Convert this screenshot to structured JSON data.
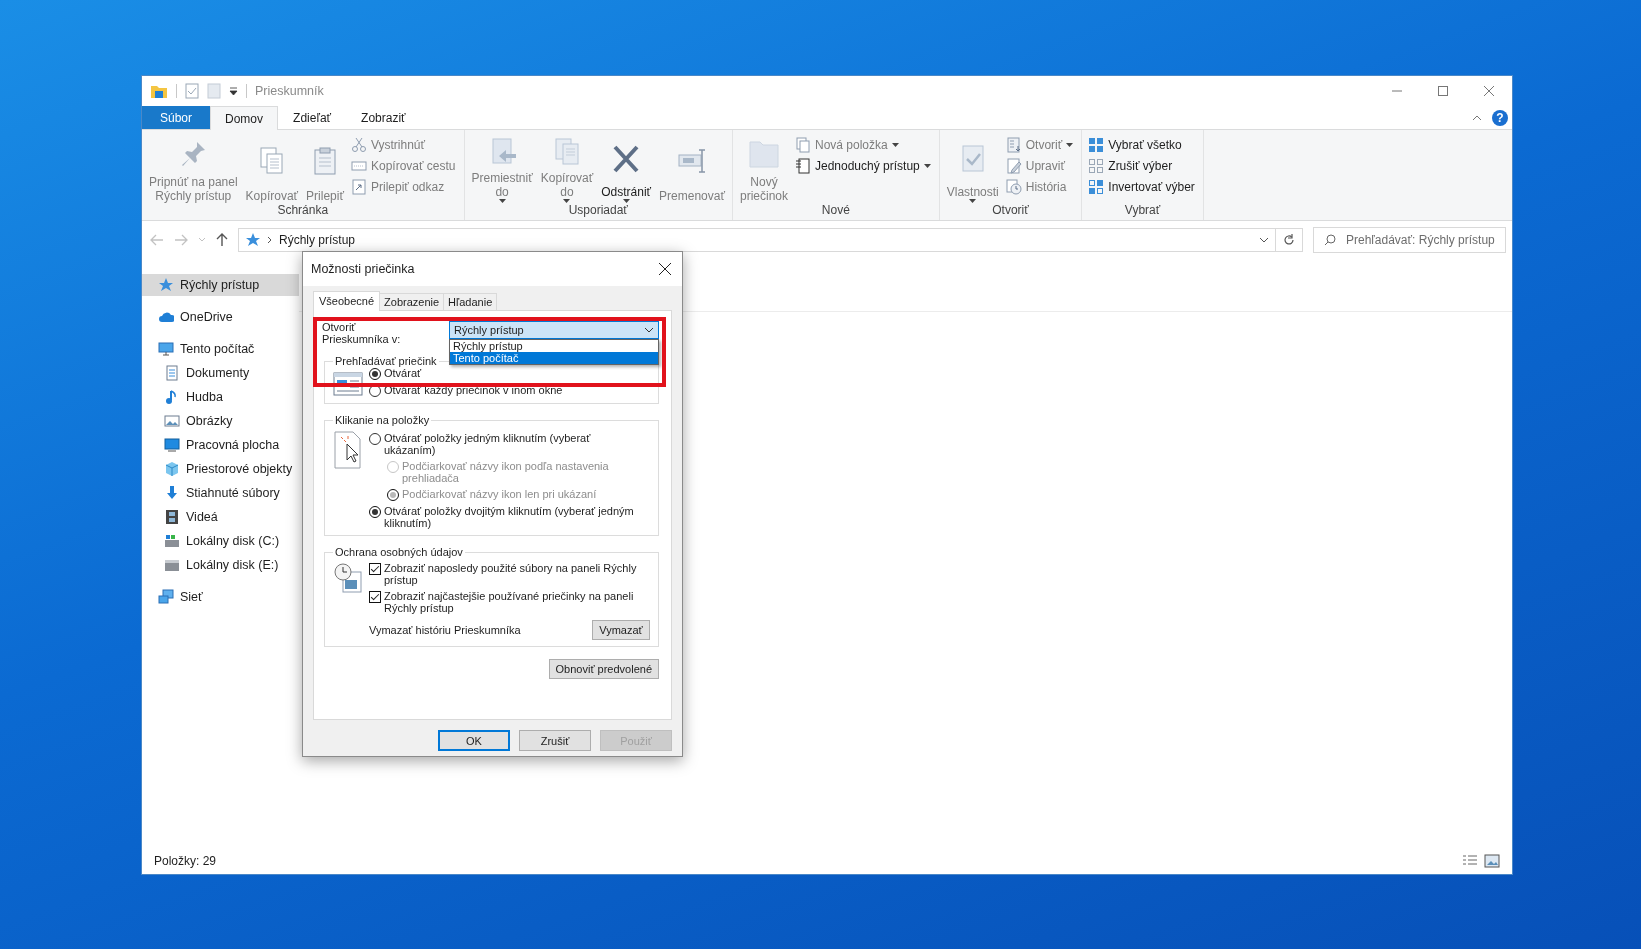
{
  "explorer": {
    "title": "Prieskumník",
    "ribbon_tabs": [
      {
        "label": "Súbor",
        "kind": "file",
        "selected": false
      },
      {
        "label": "Domov",
        "kind": "tab",
        "selected": true
      },
      {
        "label": "Zdieľať",
        "kind": "tab",
        "selected": false
      },
      {
        "label": "Zobraziť",
        "kind": "tab",
        "selected": false
      }
    ],
    "help_label": "?",
    "ribbon_groups": [
      {
        "name": "Schránka",
        "items": [
          {
            "kind": "large",
            "label": "Pripnúť na panel\nRýchly prístup",
            "disabled": true,
            "dropdown": false
          },
          {
            "kind": "large",
            "label": "Kopírovať",
            "disabled": true,
            "dropdown": false
          },
          {
            "kind": "large",
            "label": "Prilepiť",
            "disabled": true,
            "dropdown": false
          },
          {
            "kind": "small",
            "label": "Vystrihnúť",
            "disabled": true,
            "dropdown": false
          },
          {
            "kind": "small",
            "label": "Kopírovať cestu",
            "disabled": true,
            "dropdown": false
          },
          {
            "kind": "small",
            "label": "Prilepiť odkaz",
            "disabled": true,
            "dropdown": false
          }
        ]
      },
      {
        "name": "Usporiadať",
        "items": [
          {
            "kind": "large",
            "label": "Premiestniť\ndo",
            "disabled": true,
            "dropdown": true
          },
          {
            "kind": "large",
            "label": "Kopírovať\ndo",
            "disabled": true,
            "dropdown": true
          },
          {
            "kind": "large",
            "label": "Odstrániť",
            "disabled": false,
            "dropdown": true
          },
          {
            "kind": "large",
            "label": "Premenovať",
            "disabled": true,
            "dropdown": false
          }
        ]
      },
      {
        "name": "Nové",
        "items": [
          {
            "kind": "large",
            "label": "Nový\npriečinok",
            "disabled": true,
            "dropdown": false
          },
          {
            "kind": "small",
            "label": "Nová položka",
            "disabled": true,
            "dropdown": true
          },
          {
            "kind": "small",
            "label": "Jednoduchý prístup",
            "disabled": false,
            "dropdown": true
          }
        ]
      },
      {
        "name": "Otvoriť",
        "items": [
          {
            "kind": "large",
            "label": "Vlastnosti",
            "disabled": true,
            "dropdown": true
          },
          {
            "kind": "small",
            "label": "Otvoriť",
            "disabled": true,
            "dropdown": true
          },
          {
            "kind": "small",
            "label": "Upraviť",
            "disabled": true,
            "dropdown": false
          },
          {
            "kind": "small",
            "label": "História",
            "disabled": true,
            "dropdown": false
          }
        ]
      },
      {
        "name": "Vybrať",
        "items": [
          {
            "kind": "small",
            "label": "Vybrať všetko",
            "disabled": false,
            "dropdown": false
          },
          {
            "kind": "small",
            "label": "Zrušiť výber",
            "disabled": false,
            "dropdown": false
          },
          {
            "kind": "small",
            "label": "Invertovať výber",
            "disabled": false,
            "dropdown": false
          }
        ]
      }
    ],
    "nav": [
      {
        "kind": "back",
        "disabled": true
      },
      {
        "kind": "forward",
        "disabled": true
      },
      {
        "kind": "recent",
        "disabled": true
      },
      {
        "kind": "up",
        "disabled": false
      }
    ],
    "address": {
      "path": "Rýchly prístup",
      "search_placeholder": "Prehľadávať: Rýchly prístup"
    },
    "sidebar": {
      "items": [
        {
          "label": "Rýchly prístup",
          "selected": true
        },
        {
          "label": "OneDrive",
          "selected": false
        },
        {
          "label": "Tento počítač",
          "selected": false,
          "children": [
            {
              "label": "Dokumenty",
              "selected": false
            },
            {
              "label": "Hudba",
              "selected": false
            },
            {
              "label": "Obrázky",
              "selected": false
            },
            {
              "label": "Pracovná plocha",
              "selected": false
            },
            {
              "label": "Priestorové objekty",
              "selected": false
            },
            {
              "label": "Stiahnuté súbory",
              "selected": false
            },
            {
              "label": "Videá",
              "selected": false
            },
            {
              "label": "Lokálny disk (C:)",
              "selected": false
            },
            {
              "label": "Lokálny disk (E:)",
              "selected": false
            }
          ]
        },
        {
          "label": "Sieť",
          "selected": false
        }
      ]
    },
    "status_bar": {
      "item_count": "Položky: 29"
    }
  },
  "dialog": {
    "title": "Možnosti priečinka",
    "tabs": [
      {
        "label": "Všeobecné",
        "selected": true
      },
      {
        "label": "Zobrazenie",
        "selected": false
      },
      {
        "label": "Hľadanie",
        "selected": false
      }
    ],
    "open_in": {
      "label": "Otvoriť\nPrieskumníka v:",
      "value": "Rýchly prístup",
      "options": [
        {
          "label": "Rýchly prístup",
          "highlighted": false
        },
        {
          "label": "Tento počítač",
          "highlighted": true
        }
      ]
    },
    "browse_group": {
      "title": "Prehľadávať priečink",
      "options": [
        {
          "label": "Otvárať",
          "selected": true
        },
        {
          "label": "Otvárať každý priečinok v inom okne",
          "selected": false
        }
      ]
    },
    "click_group": {
      "title": "Klikanie na položky",
      "options": [
        {
          "label": "Otvárať položky jedným kliknutím (vyberať\nukázaním)",
          "selected": false,
          "disabled": false,
          "children": [
            {
              "label": "Podčiarkovať názvy ikon podľa nastavenia\nprehliadača",
              "selected": false,
              "disabled": true
            },
            {
              "label": "Podčiarkovať názvy ikon len pri ukázaní",
              "selected": true,
              "disabled": true
            }
          ]
        },
        {
          "label": "Otvárať položky dvojitým kliknutím (vyberať jedným\nkliknutím)",
          "selected": true,
          "disabled": false
        }
      ]
    },
    "privacy_group": {
      "title": "Ochrana osobných údajov",
      "checkboxes": [
        {
          "label": "Zobraziť naposledy použité súbory na paneli Rýchly\nprístup",
          "checked": true
        },
        {
          "label": "Zobraziť najčastejšie používané priečinky na paneli\nRýchly prístup",
          "checked": true
        }
      ],
      "clear_label": "Vymazať históriu Prieskumníka",
      "clear_button": "Vymazať"
    },
    "restore_button": "Obnoviť predvolené",
    "buttons": [
      {
        "label": "OK",
        "default": true,
        "disabled": false
      },
      {
        "label": "Zrušiť",
        "default": false,
        "disabled": false
      },
      {
        "label": "Použiť",
        "default": false,
        "disabled": true
      }
    ]
  }
}
